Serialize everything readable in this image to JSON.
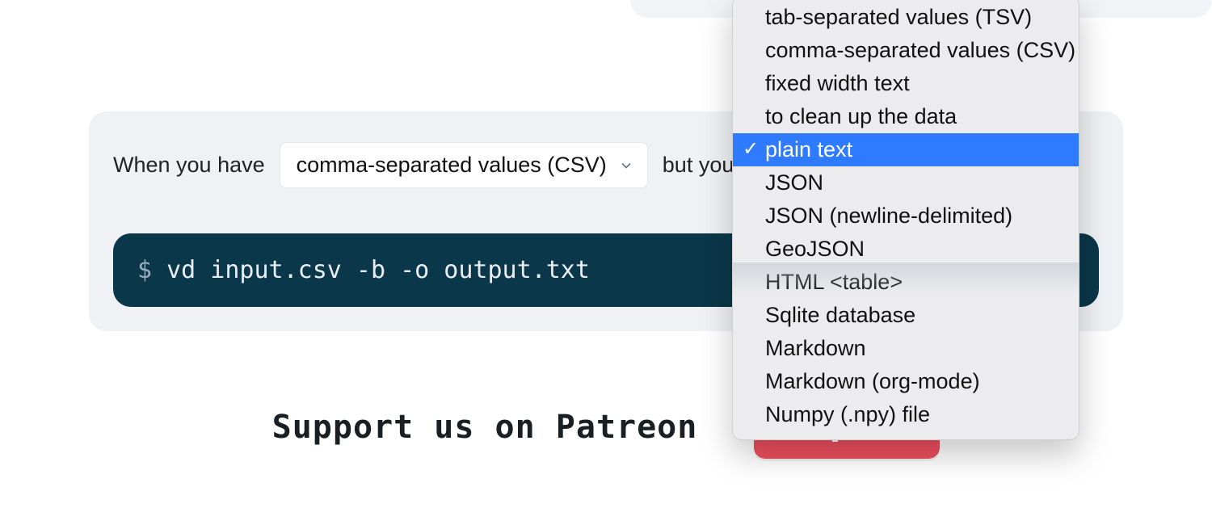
{
  "sentence": {
    "prefix": "When you have",
    "middle": "but you need"
  },
  "source_dropdown": {
    "value": "comma-separated values (CSV)"
  },
  "target_dropdown": {
    "options": [
      {
        "label": "tab-separated values (TSV)",
        "selected": false
      },
      {
        "label": "comma-separated values (CSV)",
        "selected": false
      },
      {
        "label": "fixed width text",
        "selected": false
      },
      {
        "label": "to clean up the data",
        "selected": false
      },
      {
        "label": "plain text",
        "selected": true
      },
      {
        "label": "JSON",
        "selected": false
      },
      {
        "label": "JSON (newline-delimited)",
        "selected": false
      },
      {
        "label": "GeoJSON",
        "selected": false
      },
      {
        "label": "HTML <table>",
        "selected": false
      },
      {
        "label": "Sqlite database",
        "selected": false
      },
      {
        "label": "Markdown",
        "selected": false
      },
      {
        "label": "Markdown (org-mode)",
        "selected": false
      },
      {
        "label": "Numpy (.npy) file",
        "selected": false
      }
    ]
  },
  "command": {
    "prompt": "$",
    "text": " vd input.csv -b -o output.txt"
  },
  "patreon": {
    "text": "Support us on Patreon"
  }
}
